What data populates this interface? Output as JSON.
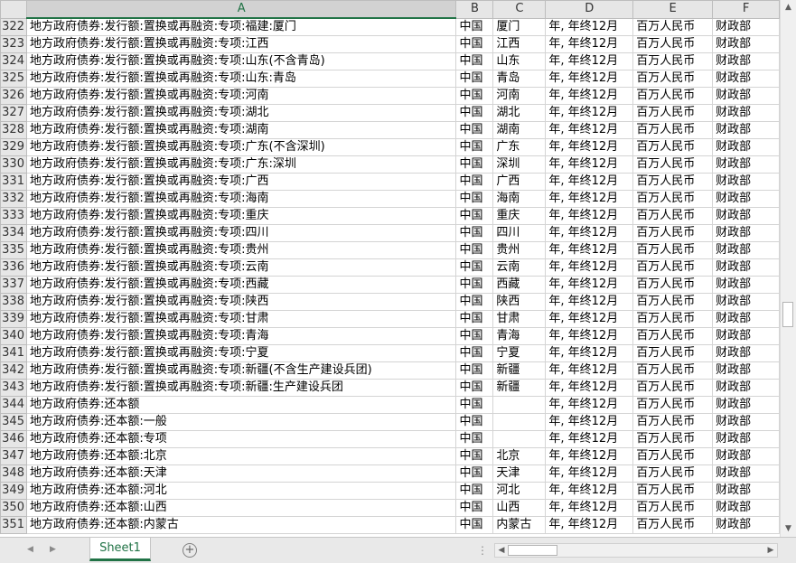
{
  "columns": [
    "A",
    "B",
    "C",
    "D",
    "E",
    "F"
  ],
  "rows": [
    {
      "n": "322",
      "a": "地方政府债券:发行额:置换或再融资:专项:福建:厦门",
      "b": "中国",
      "c": "厦门",
      "d": "年, 年终12月",
      "e": "百万人民币",
      "f": "财政部"
    },
    {
      "n": "323",
      "a": "地方政府债券:发行额:置换或再融资:专项:江西",
      "b": "中国",
      "c": "江西",
      "d": "年, 年终12月",
      "e": "百万人民币",
      "f": "财政部"
    },
    {
      "n": "324",
      "a": "地方政府债券:发行额:置换或再融资:专项:山东(不含青岛)",
      "b": "中国",
      "c": "山东",
      "d": "年, 年终12月",
      "e": "百万人民币",
      "f": "财政部"
    },
    {
      "n": "325",
      "a": "地方政府债券:发行额:置换或再融资:专项:山东:青岛",
      "b": "中国",
      "c": "青岛",
      "d": "年, 年终12月",
      "e": "百万人民币",
      "f": "财政部"
    },
    {
      "n": "326",
      "a": "地方政府债券:发行额:置换或再融资:专项:河南",
      "b": "中国",
      "c": "河南",
      "d": "年, 年终12月",
      "e": "百万人民币",
      "f": "财政部"
    },
    {
      "n": "327",
      "a": "地方政府债券:发行额:置换或再融资:专项:湖北",
      "b": "中国",
      "c": "湖北",
      "d": "年, 年终12月",
      "e": "百万人民币",
      "f": "财政部"
    },
    {
      "n": "328",
      "a": "地方政府债券:发行额:置换或再融资:专项:湖南",
      "b": "中国",
      "c": "湖南",
      "d": "年, 年终12月",
      "e": "百万人民币",
      "f": "财政部"
    },
    {
      "n": "329",
      "a": "地方政府债券:发行额:置换或再融资:专项:广东(不含深圳)",
      "b": "中国",
      "c": "广东",
      "d": "年, 年终12月",
      "e": "百万人民币",
      "f": "财政部"
    },
    {
      "n": "330",
      "a": "地方政府债券:发行额:置换或再融资:专项:广东:深圳",
      "b": "中国",
      "c": "深圳",
      "d": "年, 年终12月",
      "e": "百万人民币",
      "f": "财政部"
    },
    {
      "n": "331",
      "a": "地方政府债券:发行额:置换或再融资:专项:广西",
      "b": "中国",
      "c": "广西",
      "d": "年, 年终12月",
      "e": "百万人民币",
      "f": "财政部"
    },
    {
      "n": "332",
      "a": "地方政府债券:发行额:置换或再融资:专项:海南",
      "b": "中国",
      "c": "海南",
      "d": "年, 年终12月",
      "e": "百万人民币",
      "f": "财政部"
    },
    {
      "n": "333",
      "a": "地方政府债券:发行额:置换或再融资:专项:重庆",
      "b": "中国",
      "c": "重庆",
      "d": "年, 年终12月",
      "e": "百万人民币",
      "f": "财政部"
    },
    {
      "n": "334",
      "a": "地方政府债券:发行额:置换或再融资:专项:四川",
      "b": "中国",
      "c": "四川",
      "d": "年, 年终12月",
      "e": "百万人民币",
      "f": "财政部"
    },
    {
      "n": "335",
      "a": "地方政府债券:发行额:置换或再融资:专项:贵州",
      "b": "中国",
      "c": "贵州",
      "d": "年, 年终12月",
      "e": "百万人民币",
      "f": "财政部"
    },
    {
      "n": "336",
      "a": "地方政府债券:发行额:置换或再融资:专项:云南",
      "b": "中国",
      "c": "云南",
      "d": "年, 年终12月",
      "e": "百万人民币",
      "f": "财政部"
    },
    {
      "n": "337",
      "a": "地方政府债券:发行额:置换或再融资:专项:西藏",
      "b": "中国",
      "c": "西藏",
      "d": "年, 年终12月",
      "e": "百万人民币",
      "f": "财政部"
    },
    {
      "n": "338",
      "a": "地方政府债券:发行额:置换或再融资:专项:陕西",
      "b": "中国",
      "c": "陕西",
      "d": "年, 年终12月",
      "e": "百万人民币",
      "f": "财政部"
    },
    {
      "n": "339",
      "a": "地方政府债券:发行额:置换或再融资:专项:甘肃",
      "b": "中国",
      "c": "甘肃",
      "d": "年, 年终12月",
      "e": "百万人民币",
      "f": "财政部"
    },
    {
      "n": "340",
      "a": "地方政府债券:发行额:置换或再融资:专项:青海",
      "b": "中国",
      "c": "青海",
      "d": "年, 年终12月",
      "e": "百万人民币",
      "f": "财政部"
    },
    {
      "n": "341",
      "a": "地方政府债券:发行额:置换或再融资:专项:宁夏",
      "b": "中国",
      "c": "宁夏",
      "d": "年, 年终12月",
      "e": "百万人民币",
      "f": "财政部"
    },
    {
      "n": "342",
      "a": "地方政府债券:发行额:置换或再融资:专项:新疆(不含生产建设兵团)",
      "b": "中国",
      "c": "新疆",
      "d": "年, 年终12月",
      "e": "百万人民币",
      "f": "财政部"
    },
    {
      "n": "343",
      "a": "地方政府债券:发行额:置换或再融资:专项:新疆:生产建设兵团",
      "b": "中国",
      "c": "新疆",
      "d": "年, 年终12月",
      "e": "百万人民币",
      "f": "财政部"
    },
    {
      "n": "344",
      "a": "地方政府债券:还本额",
      "b": "中国",
      "c": "",
      "d": "年, 年终12月",
      "e": "百万人民币",
      "f": "财政部"
    },
    {
      "n": "345",
      "a": "地方政府债券:还本额:一般",
      "b": "中国",
      "c": "",
      "d": "年, 年终12月",
      "e": "百万人民币",
      "f": "财政部"
    },
    {
      "n": "346",
      "a": "地方政府债券:还本额:专项",
      "b": "中国",
      "c": "",
      "d": "年, 年终12月",
      "e": "百万人民币",
      "f": "财政部"
    },
    {
      "n": "347",
      "a": "地方政府债券:还本额:北京",
      "b": "中国",
      "c": "北京",
      "d": "年, 年终12月",
      "e": "百万人民币",
      "f": "财政部"
    },
    {
      "n": "348",
      "a": "地方政府债券:还本额:天津",
      "b": "中国",
      "c": "天津",
      "d": "年, 年终12月",
      "e": "百万人民币",
      "f": "财政部"
    },
    {
      "n": "349",
      "a": "地方政府债券:还本额:河北",
      "b": "中国",
      "c": "河北",
      "d": "年, 年终12月",
      "e": "百万人民币",
      "f": "财政部"
    },
    {
      "n": "350",
      "a": "地方政府债券:还本额:山西",
      "b": "中国",
      "c": "山西",
      "d": "年, 年终12月",
      "e": "百万人民币",
      "f": "财政部"
    },
    {
      "n": "351",
      "a": "地方政府债券:还本额:内蒙古",
      "b": "中国",
      "c": "内蒙古",
      "d": "年, 年终12月",
      "e": "百万人民币",
      "f": "财政部"
    }
  ],
  "sheet_tab": "Sheet1",
  "add_sheet_symbol": "+",
  "nav": {
    "prev": "◀",
    "next": "▶"
  },
  "scroll": {
    "up": "▲",
    "down": "▼",
    "left": "◀",
    "right": "▶"
  },
  "dots": "⋮"
}
